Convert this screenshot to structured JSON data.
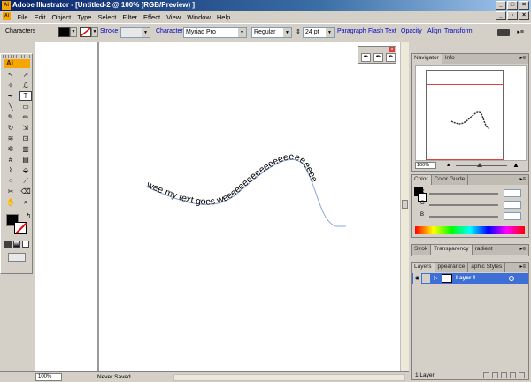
{
  "window": {
    "title": "Adobe Illustrator - [Untitled-2 @ 100% (RGB/Preview) ]",
    "app_icon": "Ai"
  },
  "menu": [
    "File",
    "Edit",
    "Object",
    "Type",
    "Select",
    "Filter",
    "Effect",
    "View",
    "Window",
    "Help"
  ],
  "controlbar": {
    "label": "Characters",
    "stroke_label": "Stroke:",
    "character_label": "Character:",
    "font": "Myriad Pro",
    "style": "Regular",
    "size": "24 pt",
    "links": [
      "Paragraph",
      "Flash Text",
      "Opacity",
      "Align",
      "Transform"
    ]
  },
  "tools": {
    "logo": "Ai"
  },
  "canvas": {
    "path_text": "wee my text goes weeeeeeeeeeeeeeeeeeeeee",
    "accent_path_color": "#8aa8d8"
  },
  "statusbar": {
    "zoom": "100%",
    "status": "Never Saved"
  },
  "navigator": {
    "tabs": [
      "Navigator",
      "Info"
    ],
    "zoom": "100%"
  },
  "color_panel": {
    "tabs": [
      "Color",
      "Color Guide"
    ],
    "channels": [
      "R",
      "G",
      "B"
    ]
  },
  "stroke_panel": {
    "tabs": [
      "Stroke",
      "Transparency",
      "Gradient"
    ],
    "tab_labels_shown": [
      "Strok",
      "Transparency",
      "radient"
    ]
  },
  "layers_panel": {
    "tabs": [
      "Layers",
      "Appearance",
      "Graphic Styles"
    ],
    "tab_labels_shown": [
      "Layers",
      "ppearance",
      "aphic Styles"
    ],
    "layer_name": "Layer 1",
    "count": "1 Layer"
  }
}
